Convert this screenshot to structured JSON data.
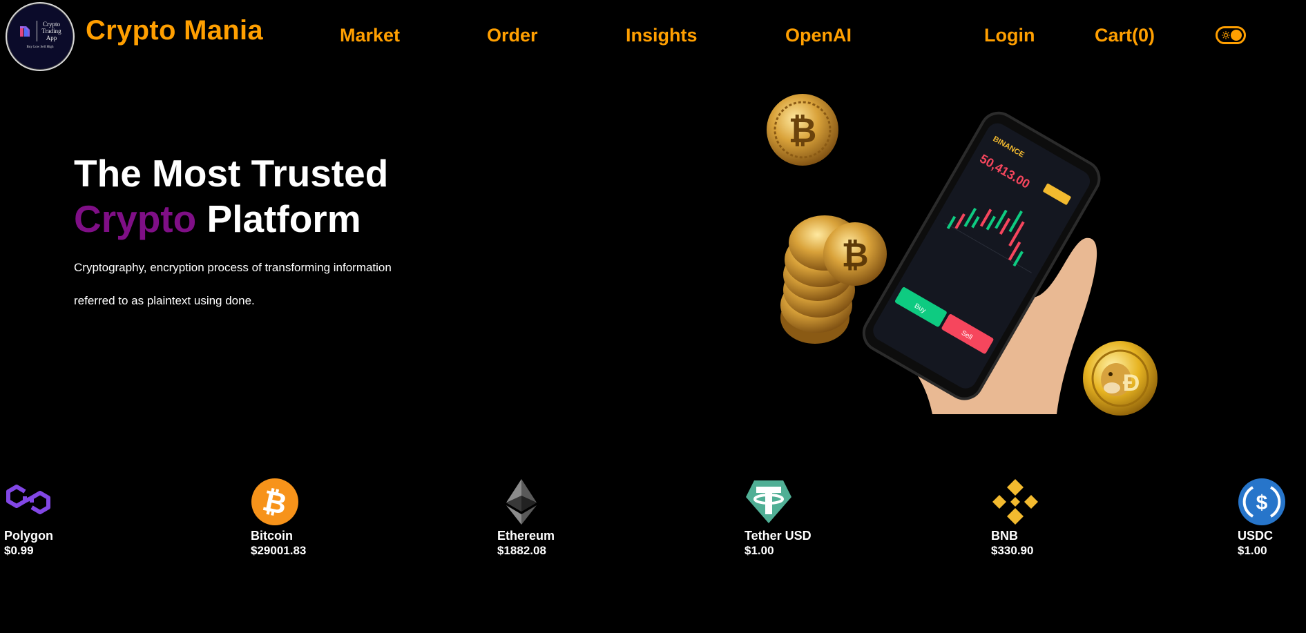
{
  "header": {
    "logo": {
      "text_lines": [
        "Crypto",
        "Trading",
        "App"
      ],
      "tagline": "Buy Low Sell High"
    },
    "brand": "Crypto Mania",
    "nav": [
      "Market",
      "Order",
      "Insights",
      "OpenAI"
    ],
    "login": "Login",
    "cart": "Cart(0)",
    "theme_toggle_icon": "sun-icon"
  },
  "hero": {
    "title_line1": "The Most Trusted",
    "title_accent": "Crypto",
    "title_rest": " Platform",
    "description_line1": "Cryptography, encryption process of transforming information",
    "description_line2": "referred to as plaintext using done.",
    "image_icon": "phone-with-trading-app-and-coins-illustration",
    "phone_screen": {
      "exchange": "BINANCE",
      "price": "50,413.00",
      "buy": "Buy",
      "sell": "Sell"
    }
  },
  "coins": [
    {
      "name": "Polygon",
      "price": "$0.99",
      "icon": "polygon-icon",
      "color": "#8247e5"
    },
    {
      "name": "Bitcoin",
      "price": "$29001.83",
      "icon": "bitcoin-icon",
      "color": "#f7931a"
    },
    {
      "name": "Ethereum",
      "price": "$1882.08",
      "icon": "ethereum-icon",
      "color": "#5a5a5a"
    },
    {
      "name": "Tether USD",
      "price": "$1.00",
      "icon": "tether-icon",
      "color": "#50af95"
    },
    {
      "name": "BNB",
      "price": "$330.90",
      "icon": "bnb-icon",
      "color": "#f3ba2f"
    },
    {
      "name": "USDC",
      "price": "$1.00",
      "icon": "usdc-icon",
      "color": "#2775ca"
    }
  ],
  "colors": {
    "accent": "#ff9f00",
    "title_accent": "#7f0f86",
    "background": "#000000"
  }
}
